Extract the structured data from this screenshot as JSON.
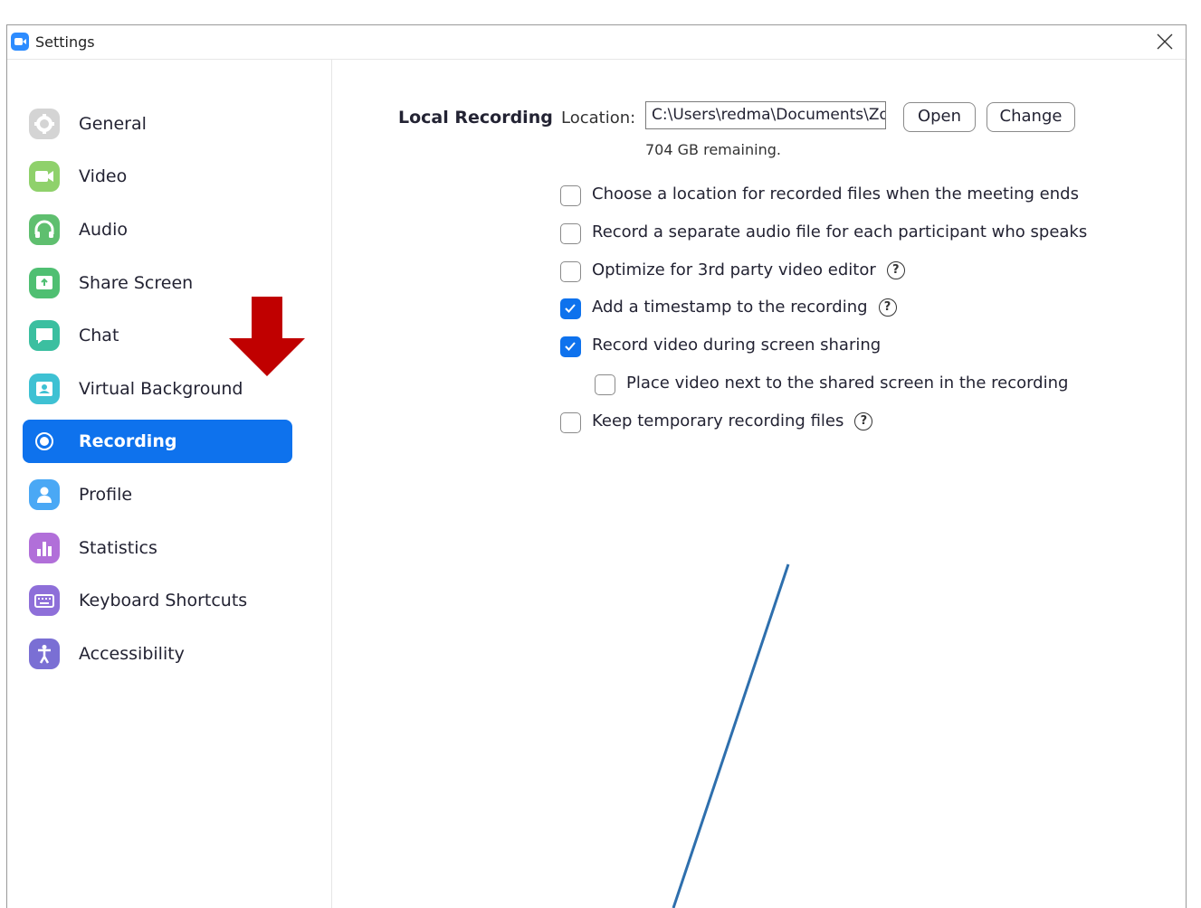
{
  "window": {
    "title": "Settings"
  },
  "sidebar": {
    "items": [
      {
        "label": "General",
        "icon": "gear-icon",
        "color": "#cfcfcf",
        "active": false
      },
      {
        "label": "Video",
        "icon": "video-camera-icon",
        "color": "#8fd16b",
        "active": false
      },
      {
        "label": "Audio",
        "icon": "headphones-icon",
        "color": "#5fbf6f",
        "active": false
      },
      {
        "label": "Share Screen",
        "icon": "share-screen-icon",
        "color": "#4fbf72",
        "active": false
      },
      {
        "label": "Chat",
        "icon": "chat-bubble-icon",
        "color": "#3bbfa0",
        "active": false
      },
      {
        "label": "Virtual Background",
        "icon": "person-frame-icon",
        "color": "#3ec1d3",
        "active": false
      },
      {
        "label": "Recording",
        "icon": "record-icon",
        "color": "#0e72ed",
        "active": true
      },
      {
        "label": "Profile",
        "icon": "user-icon",
        "color": "#4aa8f5",
        "active": false
      },
      {
        "label": "Statistics",
        "icon": "bar-chart-icon",
        "color": "#b16fd9",
        "active": false
      },
      {
        "label": "Keyboard Shortcuts",
        "icon": "keyboard-icon",
        "color": "#8e6fd9",
        "active": false
      },
      {
        "label": "Accessibility",
        "icon": "accessibility-icon",
        "color": "#7a6fd4",
        "active": false
      }
    ]
  },
  "recording": {
    "section_title": "Local Recording",
    "location_label": "Location:",
    "location_value": "C:\\Users\\redma\\Documents\\Zoom",
    "open_label": "Open",
    "change_label": "Change",
    "remaining": "704 GB remaining.",
    "options": [
      {
        "label": "Choose a location for recorded files when the meeting ends",
        "checked": false,
        "help": false,
        "indent": false
      },
      {
        "label": "Record a separate audio file for each participant who speaks",
        "checked": false,
        "help": false,
        "indent": false
      },
      {
        "label": "Optimize for 3rd party video editor",
        "checked": false,
        "help": true,
        "indent": false
      },
      {
        "label": "Add a timestamp to the recording",
        "checked": true,
        "help": true,
        "indent": false
      },
      {
        "label": "Record video during screen sharing",
        "checked": true,
        "help": false,
        "indent": false
      },
      {
        "label": "Place video next to the shared screen in the recording",
        "checked": false,
        "help": false,
        "indent": true
      },
      {
        "label": "Keep temporary recording files",
        "checked": false,
        "help": true,
        "indent": false
      }
    ]
  },
  "colors": {
    "accent": "#0e72ed",
    "annotation_arrow": "#c00000",
    "annotation_line": "#2e6fad"
  }
}
